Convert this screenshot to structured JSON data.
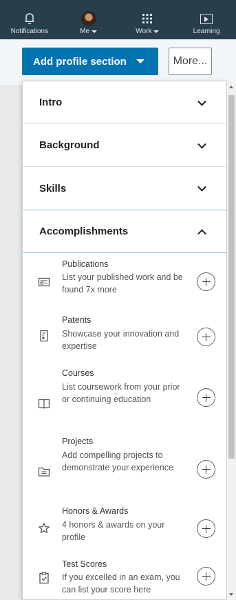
{
  "nav": {
    "items": [
      {
        "label": "Notifications",
        "icon": "bell-icon",
        "has_caret": false
      },
      {
        "label": "Me",
        "icon": "avatar",
        "has_caret": true
      },
      {
        "label": "Work",
        "icon": "grid-icon",
        "has_caret": true
      },
      {
        "label": "Learning",
        "icon": "play-icon",
        "has_caret": false
      }
    ],
    "bg_color": "#283e4a"
  },
  "actions": {
    "add_profile_section": "Add profile section",
    "more": "More...",
    "accent_color": "#0073b1"
  },
  "sections": [
    {
      "label": "Intro",
      "expanded": false
    },
    {
      "label": "Background",
      "expanded": false
    },
    {
      "label": "Skills",
      "expanded": false
    },
    {
      "label": "Accomplishments",
      "expanded": true
    }
  ],
  "accomplishments": [
    {
      "title": "Publications",
      "description": "List your published work and be found 7x more",
      "icon": "publication-icon"
    },
    {
      "title": "Patents",
      "description": "Showcase your innovation and expertise",
      "icon": "patent-icon"
    },
    {
      "title": "Courses",
      "description": "List coursework from your prior or continuing education",
      "icon": "book-icon"
    },
    {
      "title": "Projects",
      "description": "Add compelling projects to demonstrate your experience",
      "icon": "folder-icon"
    },
    {
      "title": "Honors & Awards",
      "description": "4 honors & awards on your profile",
      "icon": "star-icon"
    },
    {
      "title": "Test Scores",
      "description": "If you excelled in an exam, you can list your score here",
      "icon": "clipboard-check-icon"
    }
  ]
}
